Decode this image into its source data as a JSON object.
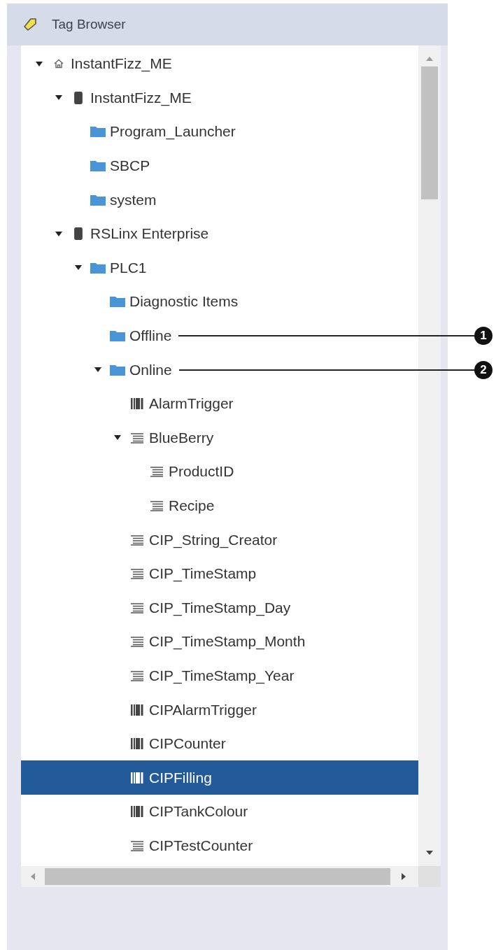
{
  "panel": {
    "title": "Tag Browser"
  },
  "tree": [
    {
      "label": "InstantFizz_ME",
      "kind": "home",
      "selected": false,
      "expanded": true,
      "children": [
        {
          "label": "InstantFizz_ME",
          "kind": "device",
          "selected": false,
          "expanded": true,
          "children": [
            {
              "label": "Program_Launcher",
              "kind": "folder",
              "selected": false
            },
            {
              "label": "SBCP",
              "kind": "folder",
              "selected": false
            },
            {
              "label": "system",
              "kind": "folder",
              "selected": false
            }
          ]
        },
        {
          "label": "RSLinx Enterprise",
          "kind": "device",
          "selected": false,
          "expanded": true,
          "children": [
            {
              "label": "PLC1",
              "kind": "folder",
              "selected": false,
              "expanded": true,
              "children": [
                {
                  "label": "Diagnostic Items",
                  "kind": "folder",
                  "selected": false
                },
                {
                  "label": "Offline",
                  "kind": "folder",
                  "selected": false,
                  "callout": "1"
                },
                {
                  "label": "Online",
                  "kind": "folder",
                  "selected": false,
                  "callout": "2",
                  "expanded": true,
                  "children": [
                    {
                      "label": "AlarmTrigger",
                      "kind": "tag",
                      "selected": false
                    },
                    {
                      "label": "BlueBerry",
                      "kind": "structure",
                      "selected": false,
                      "expanded": true,
                      "children": [
                        {
                          "label": "ProductID",
                          "kind": "structure",
                          "selected": false
                        },
                        {
                          "label": "Recipe",
                          "kind": "structure",
                          "selected": false
                        }
                      ]
                    },
                    {
                      "label": "CIP_String_Creator",
                      "kind": "structure",
                      "selected": false
                    },
                    {
                      "label": "CIP_TimeStamp",
                      "kind": "structure",
                      "selected": false
                    },
                    {
                      "label": "CIP_TimeStamp_Day",
                      "kind": "structure",
                      "selected": false
                    },
                    {
                      "label": "CIP_TimeStamp_Month",
                      "kind": "structure",
                      "selected": false
                    },
                    {
                      "label": "CIP_TimeStamp_Year",
                      "kind": "structure",
                      "selected": false
                    },
                    {
                      "label": "CIPAlarmTrigger",
                      "kind": "tag",
                      "selected": false
                    },
                    {
                      "label": "CIPCounter",
                      "kind": "tag",
                      "selected": false
                    },
                    {
                      "label": "CIPFilling",
                      "kind": "tag",
                      "selected": true
                    },
                    {
                      "label": "CIPTankColour",
                      "kind": "tag",
                      "selected": false
                    },
                    {
                      "label": "CIPTestCounter",
                      "kind": "structure",
                      "selected": false
                    }
                  ]
                }
              ]
            }
          ]
        }
      ]
    }
  ]
}
